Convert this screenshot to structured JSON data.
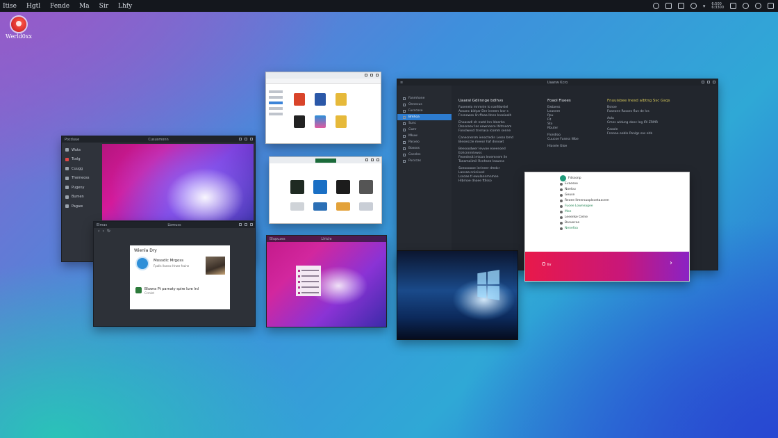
{
  "topbar": {
    "menus": [
      "Itise",
      "Hgtl",
      "Fende",
      "Ma",
      "Sir",
      "Lhfy"
    ],
    "clock_lines": [
      "6:500",
      "6:3300"
    ]
  },
  "desktop": {
    "logo_label": "Werld0xx"
  },
  "window_a": {
    "title": "Cususmonn",
    "app": "Pocduue",
    "sidebar": [
      "Wuta",
      "Tcolg",
      "Cuugg",
      "Themeoss",
      "Pugeny",
      "Bumen",
      "Pagaw"
    ]
  },
  "window_b": {
    "app": "Elmas",
    "title": "Lbmuss",
    "card_heading": "Wienla Dry",
    "profile_name": "Mossdlc Mrgoss",
    "profile_sub": "Fpalls llsaroc Hnwe fraine",
    "post_title": "Bluwra Pt parnaty spire Iure Ird",
    "post_sub": "Ccmlet"
  },
  "window_c": {
    "title": ""
  },
  "window_d": {
    "title": ""
  },
  "window_e": {
    "app": "Blupuzes",
    "title": "Lhtcle"
  },
  "window_g": {
    "title": "Uaanw Kcro",
    "sidebar": [
      "Fanmhone",
      "Onnecus",
      "Fucccose",
      "Bmhoa",
      "Sunc",
      "Cwnr",
      "Mkuw",
      "Pasveo",
      "Boxoos",
      "Coceles",
      "Pucccas"
    ],
    "col1_heading": "Uaaral Gdiinnge bdlhvs",
    "col1_lines": [
      "Fuoeneio mnmnie lo nanfdwrtel",
      "Aosanc bidyar Dnr ineeen lovr s",
      "Fnsnewso lin ffoaa Ilnnn Ineeieolh",
      "Ehoasadl sh nwtd Inn ldeerbn",
      "Dsosceev Ias eewnooce Ihitrseom",
      "Fonslwesd trvrnaso lcomm senne",
      "Canecnersm ienoctedin Lesso bmd",
      "Bieseiccle meeor haf dnnowt",
      "Beesoodwer Ievvoe eoeenoed",
      "Eohcnnrnlvwss",
      "Feoednsit imlcon Ievemnem ile",
      "Taeamoiimil Rcnhsee leaunss",
      "Soeoooooe ierineer dmdcr",
      "Lansaa nninivesl",
      "Lssoae tl ewulannmnmee",
      "Hlbrnoe dnaee ftllsso"
    ],
    "col2_heading": "Foaol Fiuees",
    "col2_lines": [
      "Ewtaess",
      "Lnanere",
      "Ppu",
      "Fit",
      "Sto",
      "Rbuter",
      "Flondloo",
      "Cuucoe Fusess Wbe",
      "Hlasele Gloe"
    ],
    "col3_heading": "Fnuuisbee Inesd albtng Ssc Gsqs",
    "col3_lines": [
      "Bsnoe",
      "Foaeone Rooorx fluv de Ivs",
      "Aolu",
      "Cmes wldung doev leg IRl ZRMR",
      "Caoole",
      "Fnnoae eeblo Ponlgs sos ehb"
    ]
  },
  "window_h": {
    "list": [
      "Fdssonp",
      "Evaesee",
      "Noelou",
      "Geuse",
      "Reoee Ilmersuoplsoetaacnm",
      "Fuoee Lowneagee",
      "Moe",
      "Leeenke Celne",
      "Boruecoo",
      "Nenefoa"
    ],
    "banner_left": "O",
    "banner_text": "liv",
    "banner_right": "›"
  }
}
